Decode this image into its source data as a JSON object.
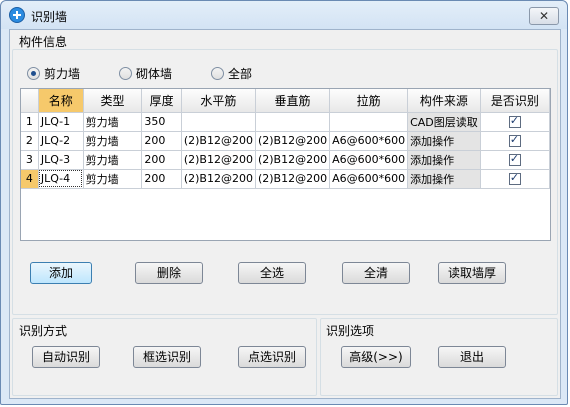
{
  "window": {
    "title": "识别墙",
    "close_label": "✕"
  },
  "component_info": {
    "group_label": "构件信息",
    "radios": [
      {
        "label": "剪力墙",
        "selected": true
      },
      {
        "label": "砌体墙",
        "selected": false
      },
      {
        "label": "全部",
        "selected": false
      }
    ]
  },
  "table": {
    "columns": [
      "",
      "名称",
      "类型",
      "厚度",
      "水平筋",
      "垂直筋",
      "拉筋",
      "构件来源",
      "是否识别"
    ],
    "rows": [
      {
        "num": "1",
        "name": "JLQ-1",
        "type": "剪力墙",
        "thickness": "350",
        "horizontal": "",
        "vertical": "",
        "tie": "",
        "source": "CAD图层读取",
        "recognize": true
      },
      {
        "num": "2",
        "name": "JLQ-2",
        "type": "剪力墙",
        "thickness": "200",
        "horizontal": "(2)B12@200",
        "vertical": "(2)B12@200",
        "tie": "A6@600*600",
        "source": "添加操作",
        "recognize": true
      },
      {
        "num": "3",
        "name": "JLQ-3",
        "type": "剪力墙",
        "thickness": "200",
        "horizontal": "(2)B12@200",
        "vertical": "(2)B12@200",
        "tie": "A6@600*600",
        "source": "添加操作",
        "recognize": true
      },
      {
        "num": "4",
        "name": "JLQ-4",
        "type": "剪力墙",
        "thickness": "200",
        "horizontal": "(2)B12@200",
        "vertical": "(2)B12@200",
        "tie": "A6@600*600",
        "source": "添加操作",
        "recognize": true
      }
    ]
  },
  "actions": {
    "add": "添加",
    "delete": "删除",
    "select_all": "全选",
    "clear_all": "全清",
    "read_thickness": "读取墙厚"
  },
  "recognition_method": {
    "group_label": "识别方式",
    "auto": "自动识别",
    "box": "框选识别",
    "point": "点选识别"
  },
  "recognition_options": {
    "group_label": "识别选项",
    "advanced": "高级(>>)",
    "exit": "退出"
  },
  "colors": {
    "selected_header": "#f6c96b",
    "titlebar": "#d3e3f4",
    "default_button": "#bee6fd"
  }
}
